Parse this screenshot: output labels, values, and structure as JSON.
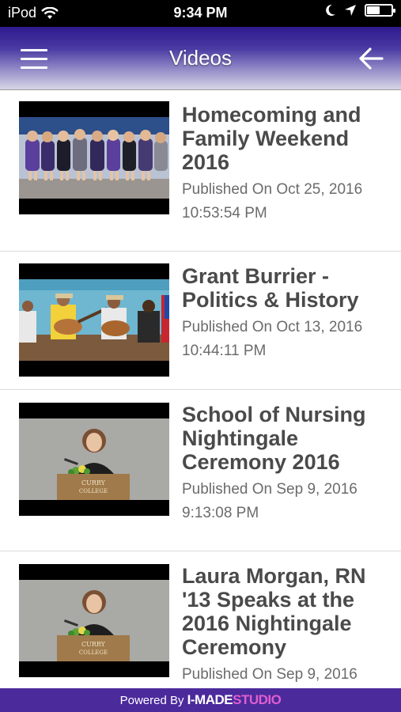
{
  "status_bar": {
    "carrier": "iPod",
    "time": "9:34 PM"
  },
  "header": {
    "title": "Videos",
    "menu_icon": "hamburger-menu-icon",
    "back_icon": "back-arrow-icon",
    "colors": {
      "gradient_top": "#2e1a8f",
      "gradient_bottom": "#d8d6e6"
    }
  },
  "videos": [
    {
      "title": "Homecoming and Family Weekend 2016",
      "published": "Published On Oct 25, 2016",
      "time": "10:53:54 PM"
    },
    {
      "title": "Grant Burrier - Politics & History",
      "published": "Published On Oct 13, 2016",
      "time": "10:44:11 PM"
    },
    {
      "title": "School of Nursing Nightingale Ceremony 2016",
      "published": "Published On Sep 9, 2016",
      "time": "9:13:08 PM"
    },
    {
      "title": "Laura Morgan, RN '13 Speaks at the 2016 Nightingale Ceremony",
      "published": "Published On Sep 9, 2016",
      "time": ""
    }
  ],
  "footer": {
    "powered_by": "Powered By",
    "brand_part1": "I-MADE",
    "brand_part2": "STUDIO",
    "colors": {
      "background": "#4b2a9c",
      "brand_accent": "#e05dd0"
    }
  }
}
